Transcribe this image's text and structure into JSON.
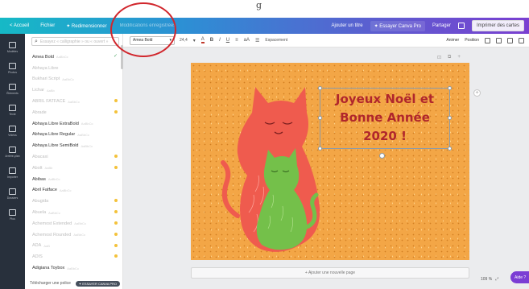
{
  "note": "Canva-style editor screenshot with a hand-drawn red circle around the font selector",
  "top_note": "g",
  "topbar": {
    "home": "< Accueil",
    "file": "Fichier",
    "resize": "✦ Redimensionner",
    "undo_hint": "Modifications enregistrées",
    "add_title": "Ajouter un titre",
    "try_pro": "✦ Essayer Canva Pro",
    "share": "Partager",
    "print": "Imprimer des cartes",
    "gradient_start": "#16b9c6",
    "gradient_end": "#7a3fd1"
  },
  "rail": [
    {
      "icon": "template-icon",
      "label": "Modèles"
    },
    {
      "icon": "photo-icon",
      "label": "Photos"
    },
    {
      "icon": "elements-icon",
      "label": "Éléments"
    },
    {
      "icon": "text-icon",
      "label": "Texte"
    },
    {
      "icon": "music-icon",
      "label": "Vidéos"
    },
    {
      "icon": "background-icon",
      "label": "Arrière-plan"
    },
    {
      "icon": "upload-icon",
      "label": "Importer"
    },
    {
      "icon": "folder-icon",
      "label": "Dossiers"
    },
    {
      "icon": "more-icon",
      "label": "Plus"
    }
  ],
  "fontpanel": {
    "search_placeholder": "Essayez « calligraphie » ou « ouvert »",
    "fonts": [
      {
        "name": "Amea Bold",
        "sub": "AaBbCc",
        "faint": false,
        "check": true,
        "crown": false
      },
      {
        "name": "Abhaya Libre",
        "sub": "",
        "faint": true,
        "check": false,
        "crown": false
      },
      {
        "name": "Bukhari Script",
        "sub": "AaBbCc",
        "faint": true,
        "check": false,
        "crown": false
      },
      {
        "name": "Lichar",
        "sub": "AaBb",
        "faint": true,
        "check": false,
        "crown": false
      },
      {
        "name": "ABRIL FATFACE",
        "sub": "AaBbCc",
        "faint": true,
        "check": false,
        "crown": true
      },
      {
        "name": "Abrade",
        "sub": "",
        "faint": true,
        "check": false,
        "crown": true
      },
      {
        "name": "Abhaya Libre ExtraBold",
        "sub": "AaBbCc",
        "faint": false,
        "check": false,
        "crown": false
      },
      {
        "name": "Abhaya Libre Regular",
        "sub": "AaBbCc",
        "faint": false,
        "check": false,
        "crown": false
      },
      {
        "name": "Abhaya Libre SemiBold",
        "sub": "AaBbCc",
        "faint": false,
        "check": false,
        "crown": false
      },
      {
        "name": "Abacaxi",
        "sub": "",
        "faint": true,
        "check": false,
        "crown": true
      },
      {
        "name": "Abolt",
        "sub": "AaBb",
        "faint": true,
        "check": false,
        "crown": true
      },
      {
        "name": "Abibas",
        "sub": "AaBbCc",
        "faint": false,
        "check": false,
        "crown": false
      },
      {
        "name": "Abril Fatface",
        "sub": "AaBbCc",
        "faint": false,
        "check": false,
        "crown": false
      },
      {
        "name": "Abugida",
        "sub": "",
        "faint": true,
        "check": false,
        "crown": true
      },
      {
        "name": "Abuela",
        "sub": "AaBbCc",
        "faint": true,
        "check": false,
        "crown": true
      },
      {
        "name": "Achemost Extended",
        "sub": "AaBbCc",
        "faint": true,
        "check": false,
        "crown": true
      },
      {
        "name": "Achemost Rounded",
        "sub": "AaBbCc",
        "faint": true,
        "check": false,
        "crown": true
      },
      {
        "name": "ADA",
        "sub": "AaB",
        "faint": true,
        "check": false,
        "crown": true
      },
      {
        "name": "ADIS",
        "sub": "",
        "faint": true,
        "check": false,
        "crown": true
      },
      {
        "name": "Adigiana Toybox",
        "sub": "AaBbCc",
        "faint": false,
        "check": false,
        "crown": false
      }
    ],
    "upload_label": "Télécharger une police",
    "upload_pill": "✦ ESSAYER CANVA PRO"
  },
  "toolbar": {
    "font_name": "Amea Bold",
    "font_size": "24,4",
    "text_color": "#c0392b",
    "bold": "B",
    "italic": "I",
    "underline": "U",
    "align": "≡",
    "case": "aA",
    "list": "☰",
    "spacing": "Espacement",
    "animate": "Animer",
    "position": "Position",
    "icons": [
      "transparency-icon",
      "link-icon",
      "copy-icon",
      "trash-icon"
    ]
  },
  "page_controls": [
    "⊡",
    "⧉",
    "+"
  ],
  "canvas": {
    "background": "#f3a646",
    "greeting_lines": [
      "Joyeux Noël et",
      "Bonne Année",
      "2020 !"
    ],
    "greeting_color": "#b0262c",
    "cat_big_color": "#ef5b4e",
    "cat_small_color": "#74c04a"
  },
  "add_page": "+ Ajouter une nouvelle page",
  "zoom": {
    "value": "109 %",
    "expand": "⤢"
  },
  "help": "Aide ?",
  "annotation_color": "#d1262c"
}
